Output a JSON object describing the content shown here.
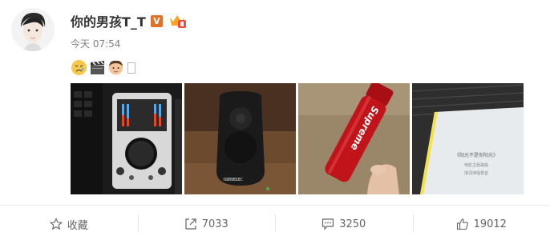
{
  "user": {
    "name": "你的男孩T_T",
    "verified_label": "V"
  },
  "post": {
    "time": "今天 07:54",
    "emojis": [
      "sad-face-emoji",
      "clapperboard-emoji",
      "man-face-emoji"
    ],
    "photos": [
      "audio-interface-photo",
      "studio-speaker-photo",
      "red-water-bottle-photo",
      "lyric-sheet-photo"
    ],
    "photo_text": {
      "bottle_brand": "Supreme",
      "sheet_title": "《阳光不是你阳光》",
      "sheet_line1": "电影主题歌曲",
      "sheet_line2": "填词演唱录音",
      "speaker_brand": "GENELEC"
    }
  },
  "actions": {
    "favorite": {
      "label": "收藏",
      "icon": "star-icon"
    },
    "repost": {
      "label": "7033",
      "icon": "share-icon"
    },
    "comment": {
      "label": "3250",
      "icon": "comment-icon"
    },
    "like": {
      "label": "19012",
      "icon": "thumbs-up-icon"
    }
  },
  "colors": {
    "verified": "#e0712a",
    "text_muted": "#808080",
    "bottle_red": "#c1141a"
  }
}
